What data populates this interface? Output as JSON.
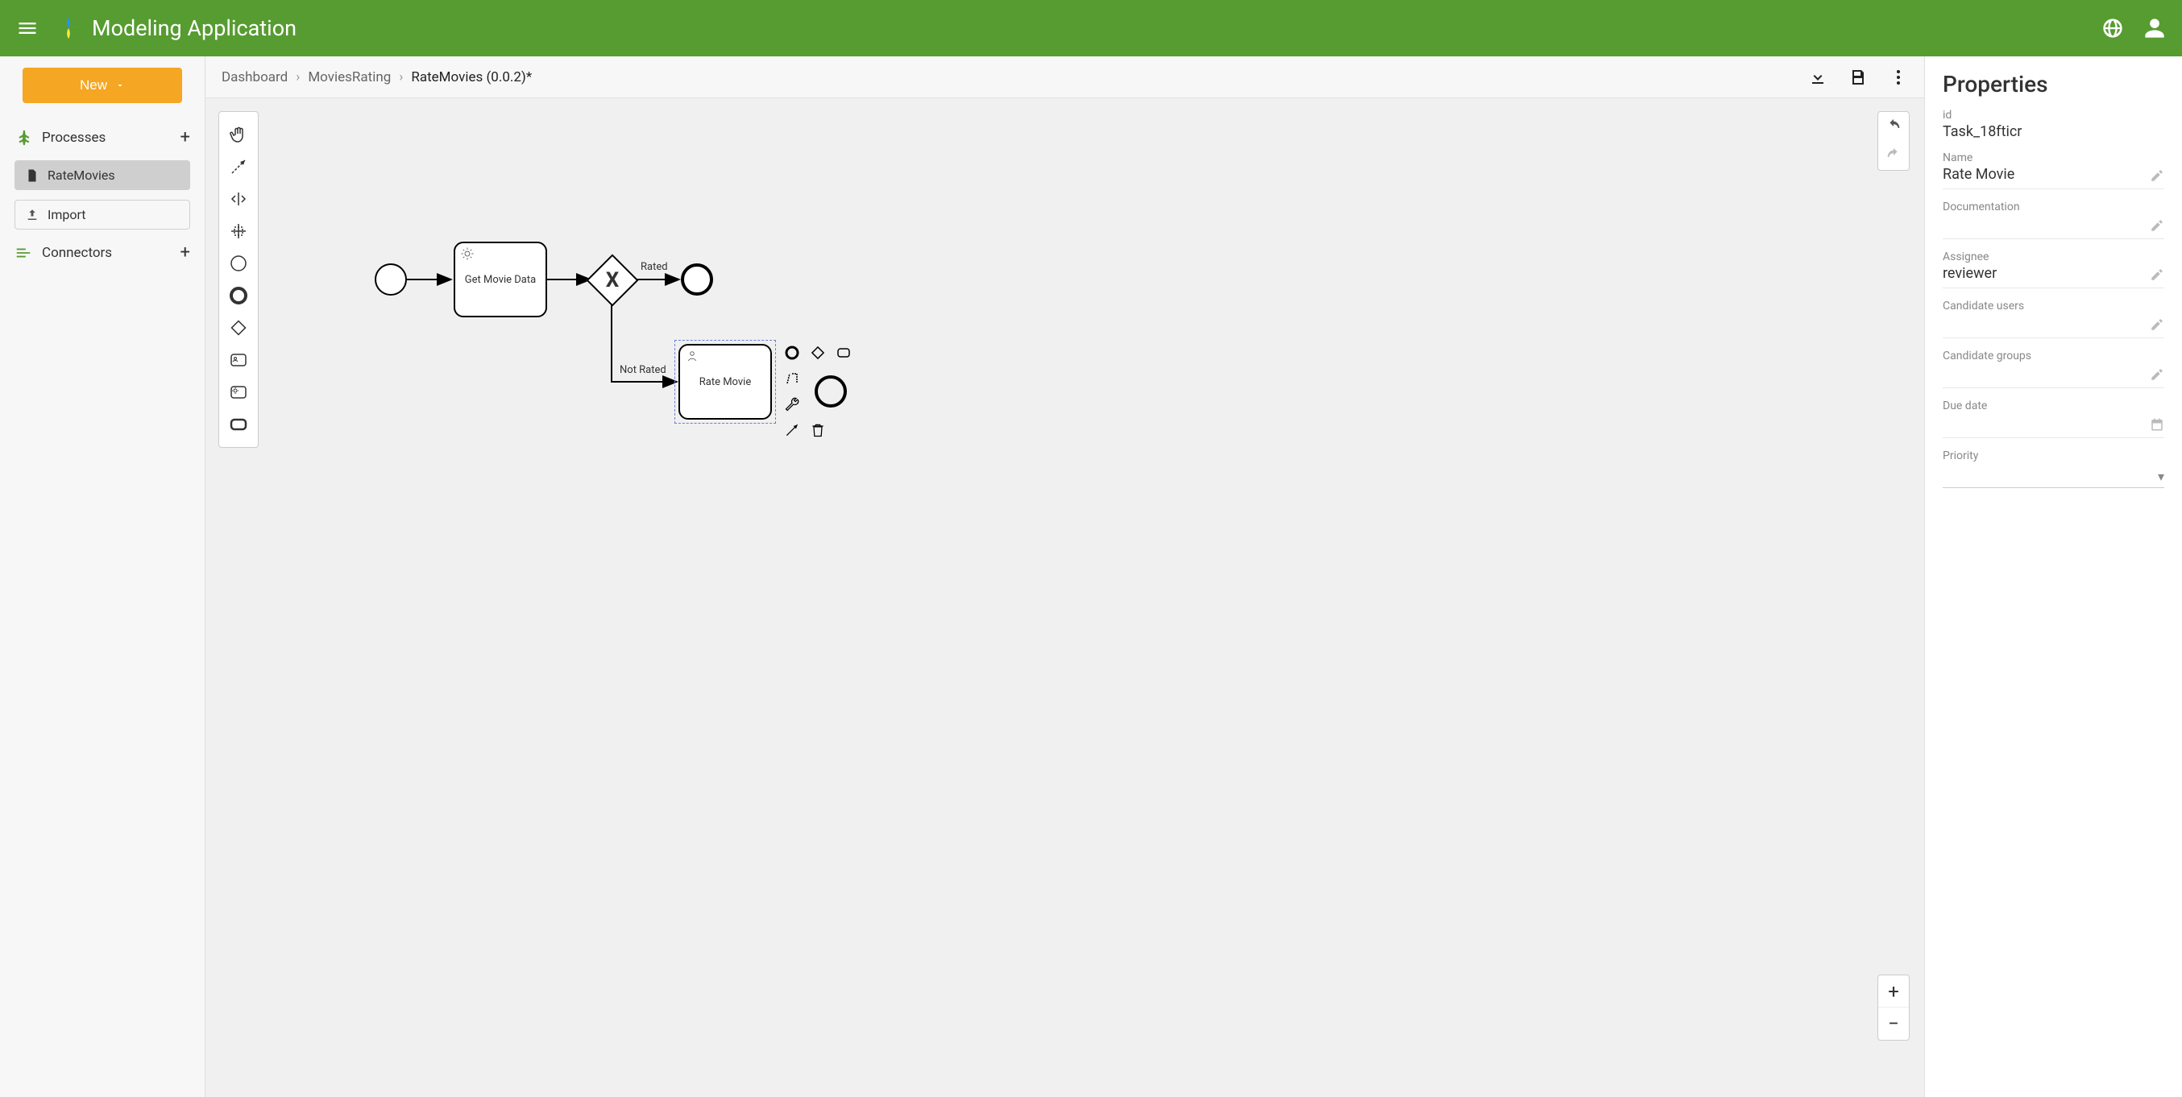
{
  "header": {
    "app_title": "Modeling Application"
  },
  "sidebar": {
    "new_button": "New",
    "sections": {
      "processes": "Processes",
      "connectors": "Connectors"
    },
    "items": {
      "rate_movies": "RateMovies",
      "import": "Import"
    }
  },
  "breadcrumb": {
    "dashboard": "Dashboard",
    "project": "MoviesRating",
    "current": "RateMovies (0.0.2)*"
  },
  "diagram": {
    "task_get_data": "Get Movie Data",
    "task_rate": "Rate Movie",
    "label_rated": "Rated",
    "label_not_rated": "Not Rated"
  },
  "properties": {
    "title": "Properties",
    "id_label": "id",
    "id_value": "Task_18fticr",
    "name_label": "Name",
    "name_value": "Rate Movie",
    "documentation_label": "Documentation",
    "documentation_value": "",
    "assignee_label": "Assignee",
    "assignee_value": "reviewer",
    "candidate_users_label": "Candidate users",
    "candidate_users_value": "",
    "candidate_groups_label": "Candidate groups",
    "candidate_groups_value": "",
    "due_date_label": "Due date",
    "due_date_value": "",
    "priority_label": "Priority",
    "priority_value": ""
  }
}
